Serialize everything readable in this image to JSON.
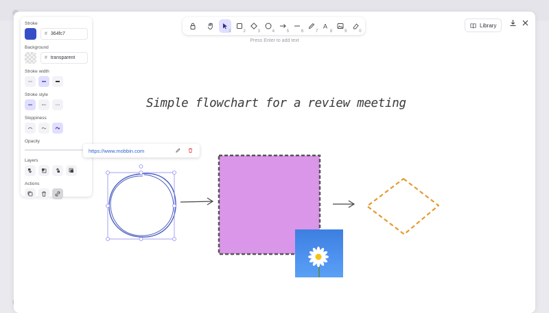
{
  "toolbar": {
    "tools": [
      {
        "name": "lock",
        "num": ""
      },
      {
        "name": "hand",
        "num": ""
      },
      {
        "name": "selection",
        "num": "1",
        "active": true
      },
      {
        "name": "rectangle",
        "num": "2"
      },
      {
        "name": "diamond",
        "num": "3"
      },
      {
        "name": "ellipse",
        "num": "4"
      },
      {
        "name": "arrow",
        "num": "5"
      },
      {
        "name": "line",
        "num": "6"
      },
      {
        "name": "draw",
        "num": "7"
      },
      {
        "name": "text",
        "num": "8"
      },
      {
        "name": "image",
        "num": "9"
      },
      {
        "name": "eraser",
        "num": "0"
      }
    ],
    "hint": "Press Enter to add text"
  },
  "library": {
    "label": "Library"
  },
  "panel": {
    "stroke_label": "Stroke",
    "stroke_color": "#364fc7",
    "stroke_hex": "364fc7",
    "background_label": "Background",
    "background_value": "transparent",
    "stroke_width_label": "Stroke width",
    "stroke_style_label": "Stroke style",
    "sloppiness_label": "Sloppiness",
    "opacity_label": "Opacity",
    "opacity_value": 100,
    "layers_label": "Layers",
    "actions_label": "Actions"
  },
  "link_popover": {
    "url": "https://www.mobbin.com"
  },
  "canvas": {
    "title": "Simple flowchart for a review meeting"
  },
  "colors": {
    "accent": "#e0dfff",
    "ellipse_stroke": "#4a5fc1",
    "rect_fill": "#da96e8",
    "diamond_stroke": "#e59a2c",
    "slider_thumb": "#1c6ee6"
  }
}
